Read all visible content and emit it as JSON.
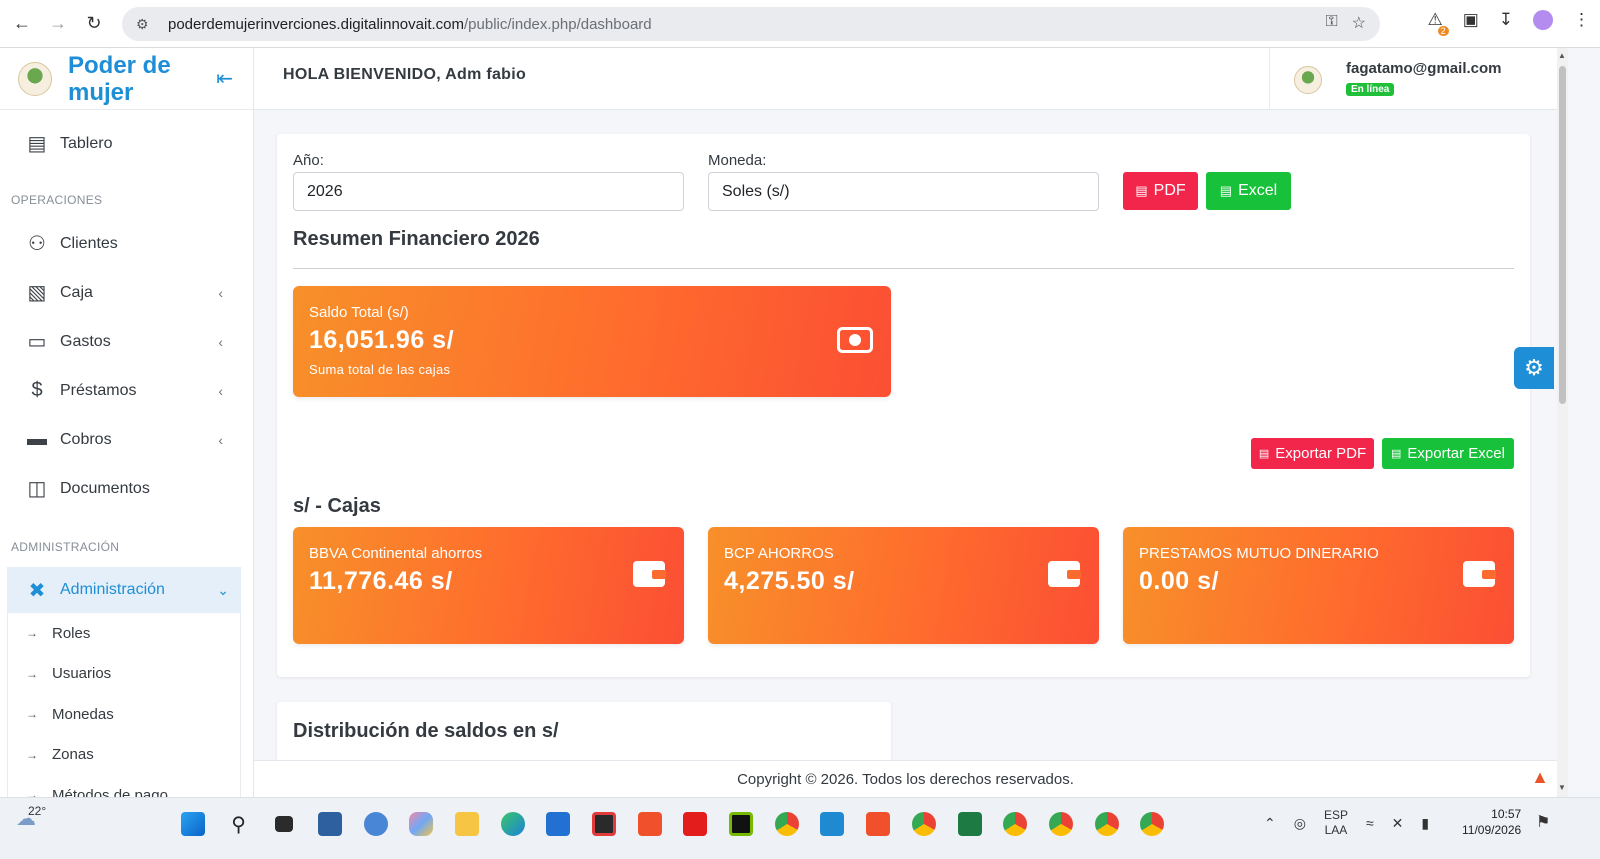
{
  "browser": {
    "url_host": "poderdemujerinverciones.digitalinnovait.com",
    "url_path": "/public/index.php/dashboard",
    "extension_badge": "2"
  },
  "sidebar": {
    "brand": "Poder de mujer",
    "items_top": [
      {
        "label": "Tablero",
        "icon": "chart-area-icon"
      }
    ],
    "section_operaciones": "OPERACIONES",
    "operaciones": [
      {
        "label": "Clientes",
        "icon": "users-icon"
      },
      {
        "label": "Caja",
        "icon": "cash-box-icon"
      },
      {
        "label": "Gastos",
        "icon": "wallet-icon"
      },
      {
        "label": "Préstamos",
        "icon": "hand-dollar-icon"
      },
      {
        "label": "Cobros",
        "icon": "credit-card-icon"
      },
      {
        "label": "Documentos",
        "icon": "folder-icon"
      }
    ],
    "section_admin": "ADMINISTRACIÓN",
    "admin_active": "Administración",
    "admin_sub": [
      "Roles",
      "Usuarios",
      "Monedas",
      "Zonas",
      "Métodos de pago"
    ]
  },
  "header": {
    "welcome": "HOLA BIENVENIDO, Adm fabio",
    "email": "fagatamo@gmail.com",
    "status": "En línea"
  },
  "filters": {
    "year_label": "Año:",
    "year_value": "2026",
    "currency_label": "Moneda:",
    "currency_value": "Soles (s/)",
    "pdf_label": "PDF",
    "excel_label": "Excel"
  },
  "summary": {
    "title": "Resumen Financiero 2026",
    "total_label": "Saldo Total (s/)",
    "total_value": "16,051.96 s/",
    "total_sub": "Suma total de las cajas"
  },
  "export": {
    "pdf_label": "Exportar PDF",
    "excel_label": "Exportar Excel"
  },
  "cajas": {
    "title": "s/ - Cajas",
    "items": [
      {
        "name": "BBVA Continental ahorros",
        "value": "11,776.46 s/"
      },
      {
        "name": "BCP AHORROS",
        "value": "4,275.50 s/"
      },
      {
        "name": "PRESTAMOS MUTUO DINERARIO",
        "value": "0.00 s/"
      }
    ]
  },
  "distribution": {
    "title": "Distribución de saldos en s/"
  },
  "footer": {
    "copyright": "Copyright © 2026. Todos los derechos reservados."
  },
  "taskbar": {
    "temperature": "22°",
    "lang_top": "ESP",
    "lang_bottom": "LAA",
    "time": "10:57",
    "date": "11/09/2026"
  },
  "colors": {
    "accent": "#1e8fd6",
    "pdf": "#f2264b",
    "excel": "#17c23a",
    "card_gradient_start": "#f7902a",
    "card_gradient_end": "#fb4f34",
    "status_online": "#1fbf3a"
  }
}
